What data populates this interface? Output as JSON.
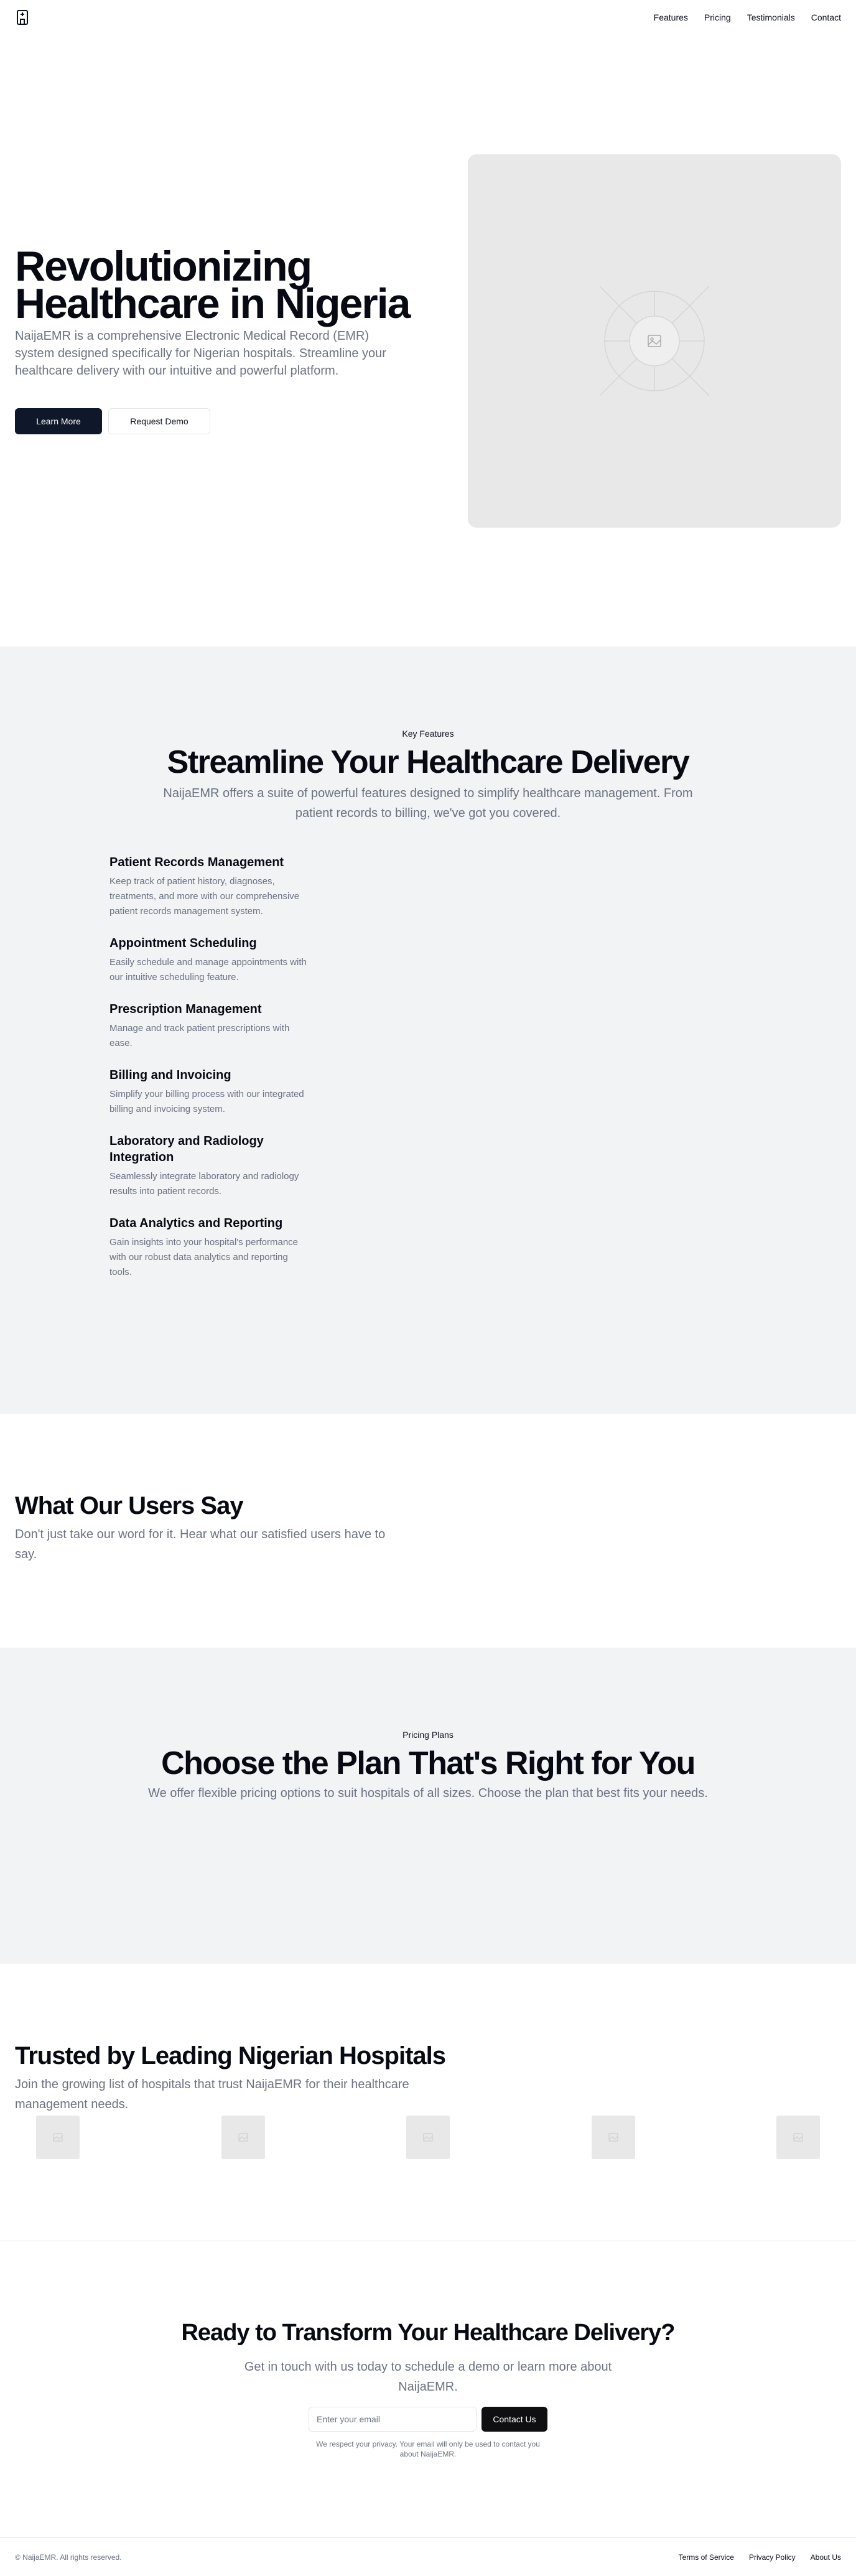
{
  "header": {
    "logo_icon": "hospital-building-icon",
    "nav": [
      {
        "label": "Features"
      },
      {
        "label": "Pricing"
      },
      {
        "label": "Testimonials"
      },
      {
        "label": "Contact"
      }
    ]
  },
  "hero": {
    "title": "Revolutionizing Healthcare in Nigeria",
    "subtitle": "NaijaEMR is a comprehensive Electronic Medical Record (EMR) system designed specifically for Nigerian hospitals. Streamline your healthcare delivery with our intuitive and powerful platform.",
    "primary_button": "Learn More",
    "secondary_button": "Request Demo",
    "image_icon": "image-placeholder-icon"
  },
  "features": {
    "eyebrow": "Key Features",
    "title": "Streamline Your Healthcare Delivery",
    "subtitle": "NaijaEMR offers a suite of powerful features designed to simplify healthcare management. From patient records to billing, we've got you covered.",
    "items": [
      {
        "title": "Patient Records Management",
        "description": "Keep track of patient history, diagnoses, treatments, and more with our comprehensive patient records management system."
      },
      {
        "title": "Appointment Scheduling",
        "description": "Easily schedule and manage appointments with our intuitive scheduling feature."
      },
      {
        "title": "Prescription Management",
        "description": "Manage and track patient prescriptions with ease."
      },
      {
        "title": "Billing and Invoicing",
        "description": "Simplify your billing process with our integrated billing and invoicing system."
      },
      {
        "title": "Laboratory and Radiology Integration",
        "description": "Seamlessly integrate laboratory and radiology results into patient records."
      },
      {
        "title": "Data Analytics and Reporting",
        "description": "Gain insights into your hospital's performance with our robust data analytics and reporting tools."
      }
    ]
  },
  "testimonials": {
    "title": "What Our Users Say",
    "subtitle": "Don't just take our word for it. Hear what our satisfied users have to say."
  },
  "pricing": {
    "eyebrow": "Pricing Plans",
    "title": "Choose the Plan That's Right for You",
    "subtitle": "We offer flexible pricing options to suit hospitals of all sizes. Choose the plan that best fits your needs."
  },
  "trusted": {
    "title": "Trusted by Leading Nigerian Hospitals",
    "subtitle": "Join the growing list of hospitals that trust NaijaEMR for their healthcare management needs.",
    "logo_icon": "hospital-logo-placeholder-icon"
  },
  "cta": {
    "title": "Ready to Transform Your Healthcare Delivery?",
    "subtitle": "Get in touch with us today to schedule a demo or learn more about NaijaEMR.",
    "email_placeholder": "Enter your email",
    "email_value": "",
    "button": "Contact Us",
    "note": "We respect your privacy. Your email will only be used to contact you about NaijaEMR."
  },
  "footer": {
    "copyright": "© NaijaEMR. All rights reserved.",
    "links": [
      {
        "label": "Terms of Service"
      },
      {
        "label": "Privacy Policy"
      },
      {
        "label": "About Us"
      }
    ]
  },
  "colors": {
    "primary_dark": "#0f172a",
    "muted_text": "#6b7280",
    "section_gray": "#f1f3f5",
    "placeholder_gray": "#e8e8e8"
  }
}
